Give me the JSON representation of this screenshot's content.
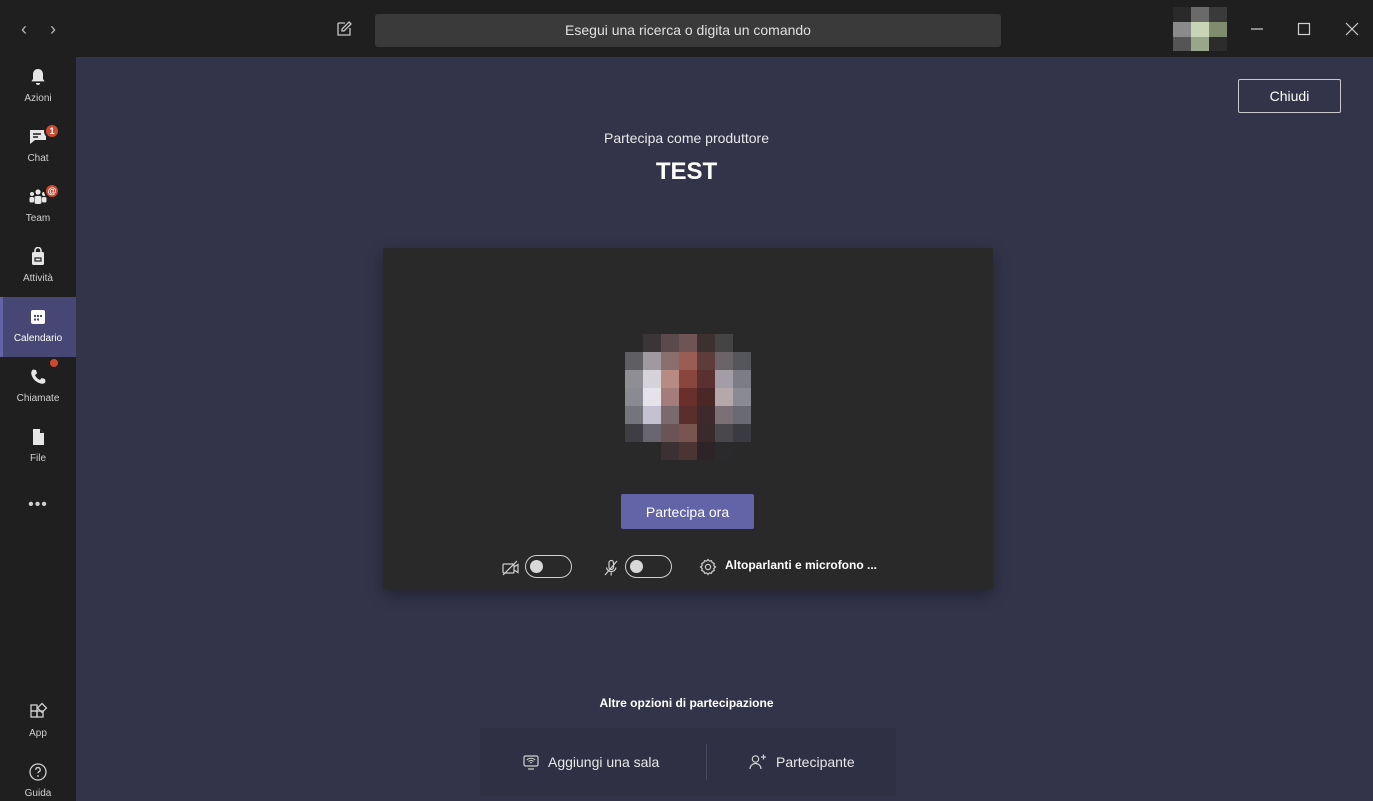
{
  "titlebar": {
    "search_placeholder": "Esegui una ricerca o digita un comando",
    "back_glyph": "‹",
    "forward_glyph": "›"
  },
  "rail": {
    "items": [
      {
        "label": "Azioni",
        "icon": "bell-icon"
      },
      {
        "label": "Chat",
        "icon": "chat-icon",
        "badge": "1"
      },
      {
        "label": "Team",
        "icon": "teams-icon",
        "badge": "@"
      },
      {
        "label": "Attività",
        "icon": "briefcase-icon"
      },
      {
        "label": "Calendario",
        "icon": "calendar-icon",
        "active": true
      },
      {
        "label": "Chiamate",
        "icon": "phone-icon",
        "dot": true
      },
      {
        "label": "File",
        "icon": "file-icon"
      }
    ],
    "more": "•••",
    "bottom": [
      {
        "label": "App",
        "icon": "apps-icon"
      },
      {
        "label": "Guida",
        "icon": "help-icon"
      }
    ]
  },
  "main": {
    "close_label": "Chiudi",
    "subtitle": "Partecipa come produttore",
    "title": "TEST",
    "join_label": "Partecipa ora",
    "device_label": "Altoparlanti e microfono ...",
    "other_options_title": "Altre opzioni di partecipazione",
    "add_room_label": "Aggiungi una sala",
    "participant_label": "Partecipante"
  },
  "colors": {
    "accent": "#6264a7",
    "badge": "#cc4a31",
    "background": "#33344a",
    "rail": "#1f1f1f"
  }
}
